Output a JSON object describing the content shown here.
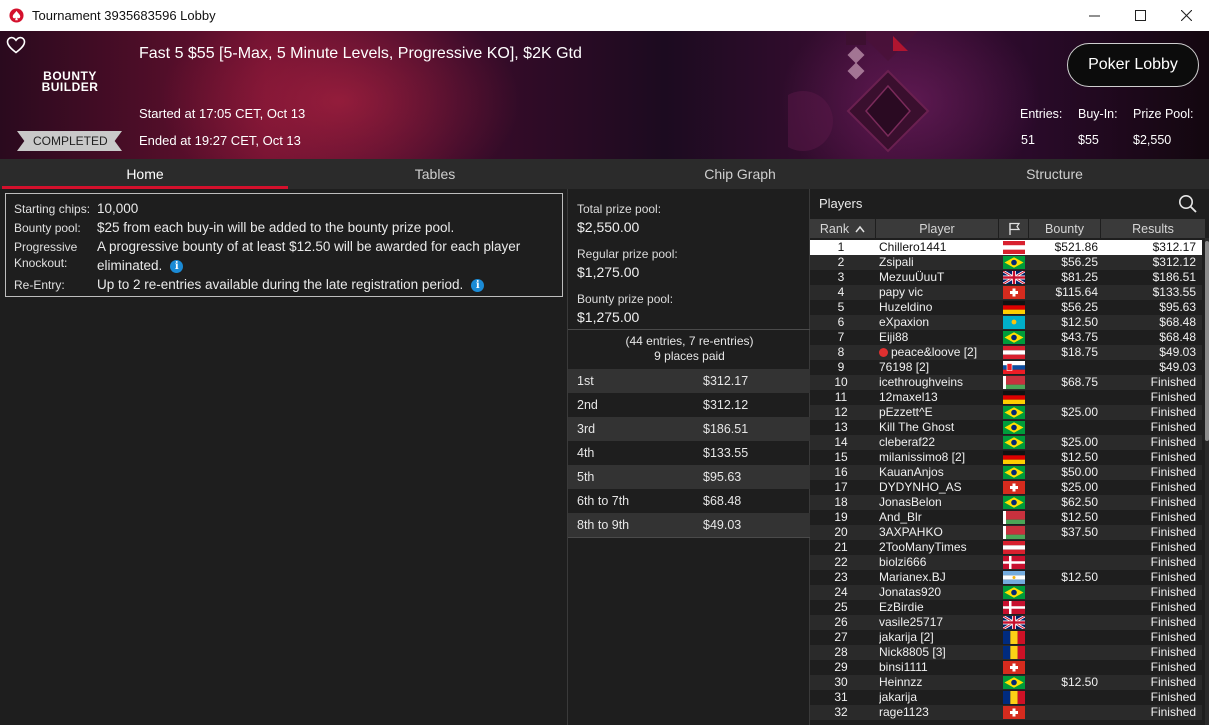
{
  "window": {
    "title": "Tournament 3935683596 Lobby",
    "minimize": "–",
    "maximize": "☐",
    "close": "✕"
  },
  "banner": {
    "logo_line1": "BOUNTY",
    "logo_line2": "BUILDER",
    "status_badge": "COMPLETED",
    "tournament_name": "Fast 5 $55 [5-Max, 5 Minute Levels, Progressive KO], $2K Gtd",
    "started": "Started at 17:05 CET, Oct 13",
    "ended": "Ended at 19:27 CET, Oct 13",
    "poker_lobby_button": "Poker Lobby",
    "entries_label": "Entries:",
    "entries_value": "51",
    "buyin_label": "Buy-In:",
    "buyin_value": "$55",
    "prizepool_label": "Prize Pool:",
    "prizepool_value": "$2,550"
  },
  "tabs": [
    {
      "label": "Home",
      "active": true
    },
    {
      "label": "Tables",
      "active": false
    },
    {
      "label": "Chip Graph",
      "active": false
    },
    {
      "label": "Structure",
      "active": false
    }
  ],
  "info": {
    "starting_chips_label": "Starting chips:",
    "starting_chips_value": "10,000",
    "bounty_pool_label": "Bounty pool:",
    "bounty_pool_value": "$25 from each buy-in will be added to the bounty prize pool.",
    "progressive_label_1": "Progressive",
    "progressive_label_2": "Knockout:",
    "progressive_value_1": "A progressive bounty of at least $12.50 will be awarded for each player",
    "progressive_value_2": "eliminated.",
    "reentry_label": "Re-Entry:",
    "reentry_value": "Up to 2 re-entries available during the late registration period."
  },
  "prizes": {
    "total_label": "Total prize pool:",
    "total_value": "$2,550.00",
    "regular_label": "Regular prize pool:",
    "regular_value": "$1,275.00",
    "bounty_label": "Bounty prize pool:",
    "bounty_value": "$1,275.00",
    "entries_info": "(44 entries, 7 re-entries)",
    "places_paid": "9 places paid",
    "payouts": [
      {
        "place": "1st",
        "amount": "$312.17"
      },
      {
        "place": "2nd",
        "amount": "$312.12"
      },
      {
        "place": "3rd",
        "amount": "$186.51"
      },
      {
        "place": "4th",
        "amount": "$133.55"
      },
      {
        "place": "5th",
        "amount": "$95.63"
      },
      {
        "place": "6th to 7th",
        "amount": "$68.48"
      },
      {
        "place": "8th to 9th",
        "amount": "$49.03"
      }
    ]
  },
  "players": {
    "title": "Players",
    "columns": {
      "rank": "Rank",
      "player": "Player",
      "bounty": "Bounty",
      "results": "Results"
    },
    "rows": [
      {
        "rank": "1",
        "name": "Chillero1441",
        "flag": "austria",
        "bounty": "$521.86",
        "result": "$312.17"
      },
      {
        "rank": "2",
        "name": "Zsipali",
        "flag": "brazil",
        "bounty": "$56.25",
        "result": "$312.12"
      },
      {
        "rank": "3",
        "name": "MezuuÜuuT",
        "flag": "uk",
        "bounty": "$81.25",
        "result": "$186.51"
      },
      {
        "rank": "4",
        "name": "papy vic",
        "flag": "switzerland",
        "bounty": "$115.64",
        "result": "$133.55"
      },
      {
        "rank": "5",
        "name": "Huzeldino",
        "flag": "germany",
        "bounty": "$56.25",
        "result": "$95.63"
      },
      {
        "rank": "6",
        "name": "eXpaxion",
        "flag": "kazakhstan",
        "bounty": "$12.50",
        "result": "$68.48"
      },
      {
        "rank": "7",
        "name": "Eiji88",
        "flag": "brazil",
        "bounty": "$43.75",
        "result": "$68.48"
      },
      {
        "rank": "8",
        "name": "peace&loove [2]",
        "flag": "austria",
        "bounty": "$18.75",
        "result": "$49.03",
        "star": true
      },
      {
        "rank": "9",
        "name": "76198 [2]",
        "flag": "slovakia",
        "bounty": "",
        "result": "$49.03"
      },
      {
        "rank": "10",
        "name": "icethroughveins",
        "flag": "belarus",
        "bounty": "$68.75",
        "result": "Finished"
      },
      {
        "rank": "11",
        "name": "12maxel13",
        "flag": "germany",
        "bounty": "",
        "result": "Finished"
      },
      {
        "rank": "12",
        "name": "pEzzett^E",
        "flag": "brazil",
        "bounty": "$25.00",
        "result": "Finished"
      },
      {
        "rank": "13",
        "name": "Kill The Ghost",
        "flag": "brazil",
        "bounty": "",
        "result": "Finished"
      },
      {
        "rank": "14",
        "name": "cleberaf22",
        "flag": "brazil",
        "bounty": "$25.00",
        "result": "Finished"
      },
      {
        "rank": "15",
        "name": "milanissimo8 [2]",
        "flag": "germany",
        "bounty": "$12.50",
        "result": "Finished"
      },
      {
        "rank": "16",
        "name": "KauanAnjos",
        "flag": "brazil",
        "bounty": "$50.00",
        "result": "Finished"
      },
      {
        "rank": "17",
        "name": "DYDYNHO_AS",
        "flag": "switzerland",
        "bounty": "$25.00",
        "result": "Finished"
      },
      {
        "rank": "18",
        "name": "JonasBelon",
        "flag": "brazil",
        "bounty": "$62.50",
        "result": "Finished"
      },
      {
        "rank": "19",
        "name": "And_Blr",
        "flag": "belarus",
        "bounty": "$12.50",
        "result": "Finished"
      },
      {
        "rank": "20",
        "name": "3AXPAHKO",
        "flag": "belarus",
        "bounty": "$37.50",
        "result": "Finished"
      },
      {
        "rank": "21",
        "name": "2TooManyTimes",
        "flag": "austria",
        "bounty": "",
        "result": "Finished"
      },
      {
        "rank": "22",
        "name": "biolzi666",
        "flag": "denmark",
        "bounty": "",
        "result": "Finished"
      },
      {
        "rank": "23",
        "name": "Marianex.BJ",
        "flag": "argentina",
        "bounty": "$12.50",
        "result": "Finished"
      },
      {
        "rank": "24",
        "name": "Jonatas920",
        "flag": "brazil",
        "bounty": "",
        "result": "Finished"
      },
      {
        "rank": "25",
        "name": "EzBirdie",
        "flag": "denmark",
        "bounty": "",
        "result": "Finished"
      },
      {
        "rank": "26",
        "name": "vasile25717",
        "flag": "uk",
        "bounty": "",
        "result": "Finished"
      },
      {
        "rank": "27",
        "name": "jakarija [2]",
        "flag": "romania",
        "bounty": "",
        "result": "Finished"
      },
      {
        "rank": "28",
        "name": "Nick8805 [3]",
        "flag": "romania",
        "bounty": "",
        "result": "Finished"
      },
      {
        "rank": "29",
        "name": "binsi1111",
        "flag": "switzerland",
        "bounty": "",
        "result": "Finished"
      },
      {
        "rank": "30",
        "name": "Heinnzz",
        "flag": "brazil",
        "bounty": "$12.50",
        "result": "Finished"
      },
      {
        "rank": "31",
        "name": "jakarija",
        "flag": "romania",
        "bounty": "",
        "result": "Finished"
      },
      {
        "rank": "32",
        "name": "rage1123",
        "flag": "switzerland",
        "bounty": "",
        "result": "Finished"
      }
    ]
  },
  "colors": {
    "accent_red": "#d4102c",
    "info_blue": "#1b8bd6",
    "panel_bg": "#1e1e1e"
  }
}
